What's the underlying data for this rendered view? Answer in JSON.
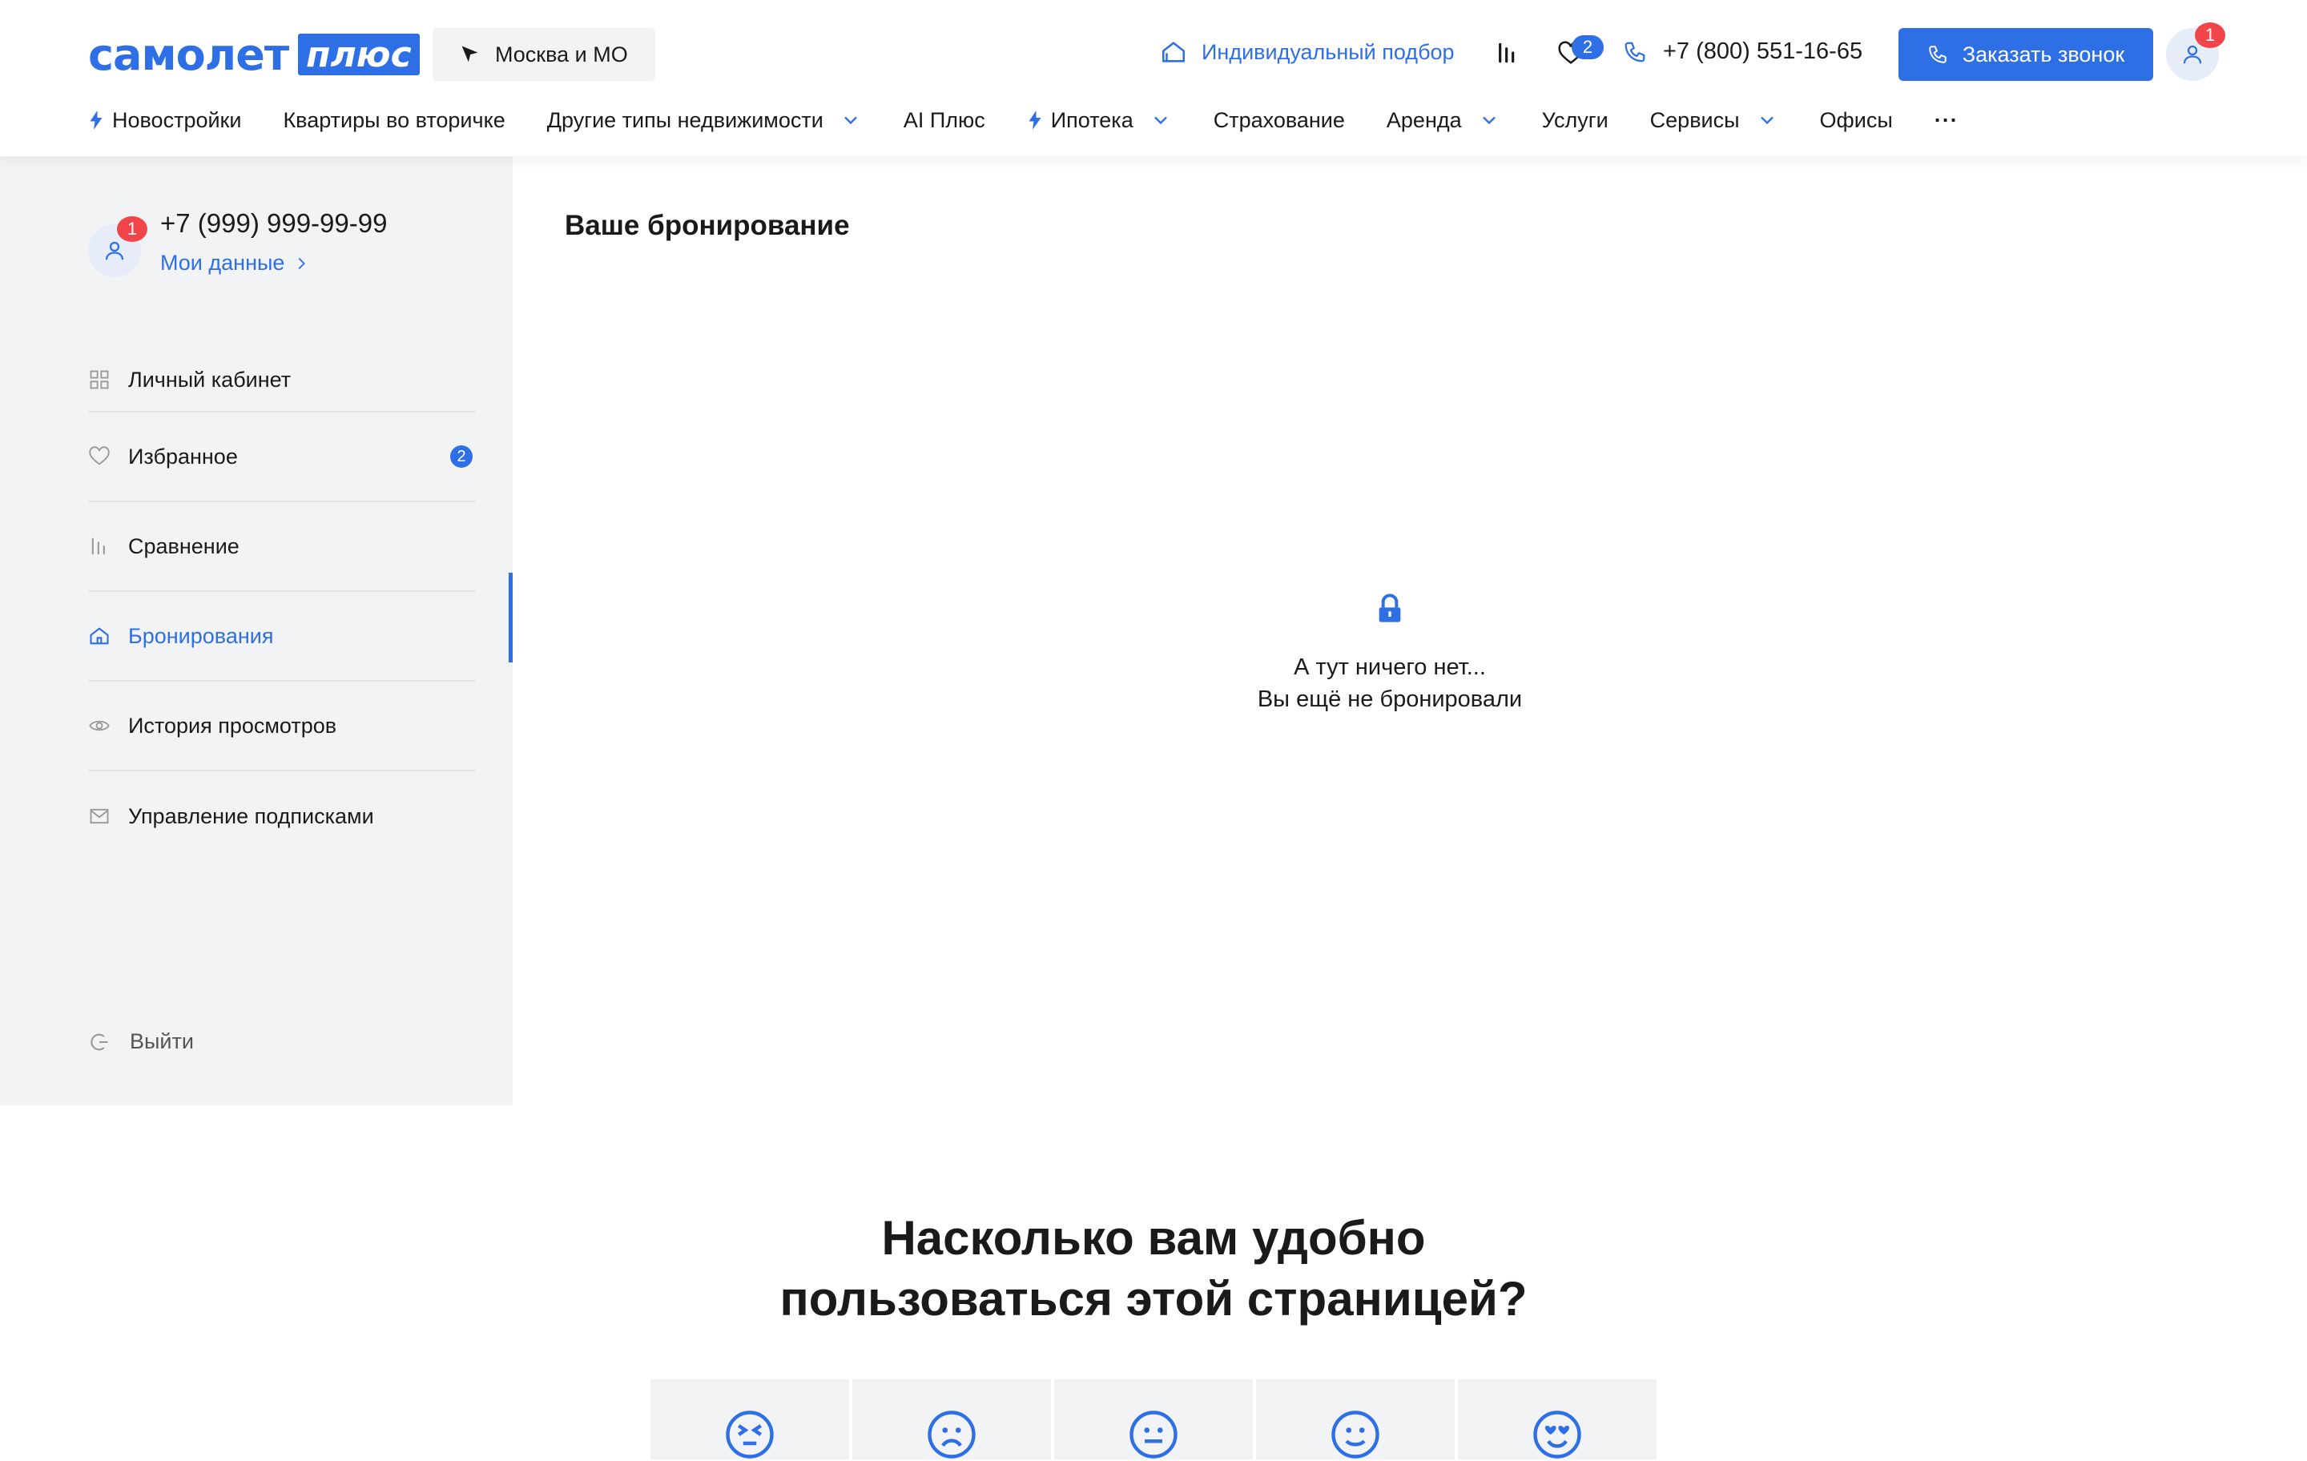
{
  "header": {
    "logo_word": "самолет",
    "logo_badge": "плюс",
    "region": "Москва и МО",
    "individual_pick": "Индивидуальный подбор",
    "favorites_count": "2",
    "phone": "+7 (800) 551-16-65",
    "call_button": "Заказать звонок",
    "profile_badge": "1",
    "accent_color": "#2e6fe6",
    "nav": [
      {
        "label": "Новостройки",
        "icon": "bolt-icon"
      },
      {
        "label": "Квартиры во вторичке"
      },
      {
        "label": "Другие типы недвижимости",
        "dropdown": true
      },
      {
        "label": "AI Плюс"
      },
      {
        "label": "Ипотека",
        "icon": "bolt-icon",
        "dropdown": true
      },
      {
        "label": "Страхование"
      },
      {
        "label": "Аренда",
        "dropdown": true
      },
      {
        "label": "Услуги"
      },
      {
        "label": "Сервисы",
        "dropdown": true
      },
      {
        "label": "Офисы"
      },
      {
        "label": "···"
      }
    ]
  },
  "sidebar": {
    "profile_phone": "+7 (999) 999-99-99",
    "profile_link": "Мои данные",
    "profile_badge": "1",
    "items": [
      {
        "label": "Личный кабинет",
        "icon": "grid-icon"
      },
      {
        "label": "Избранное",
        "icon": "heart-icon",
        "count": "2"
      },
      {
        "label": "Сравнение",
        "icon": "compare-icon"
      },
      {
        "label": "Бронирования",
        "icon": "home-icon",
        "active": true
      },
      {
        "label": "История просмотров",
        "icon": "eye-icon"
      },
      {
        "label": "Управление подписками",
        "icon": "mail-icon"
      }
    ],
    "logout": "Выйти"
  },
  "main": {
    "title": "Ваше бронирование",
    "empty_line1": "А тут ничего нет...",
    "empty_line2": "Вы ещё не бронировали"
  },
  "survey": {
    "title_line1": "Насколько вам удобно",
    "title_line2": "пользоваться этой страницей?",
    "ratings": [
      "very-bad-face-icon",
      "sad-face-icon",
      "neutral-face-icon",
      "slight-smile-face-icon",
      "love-face-icon"
    ]
  }
}
